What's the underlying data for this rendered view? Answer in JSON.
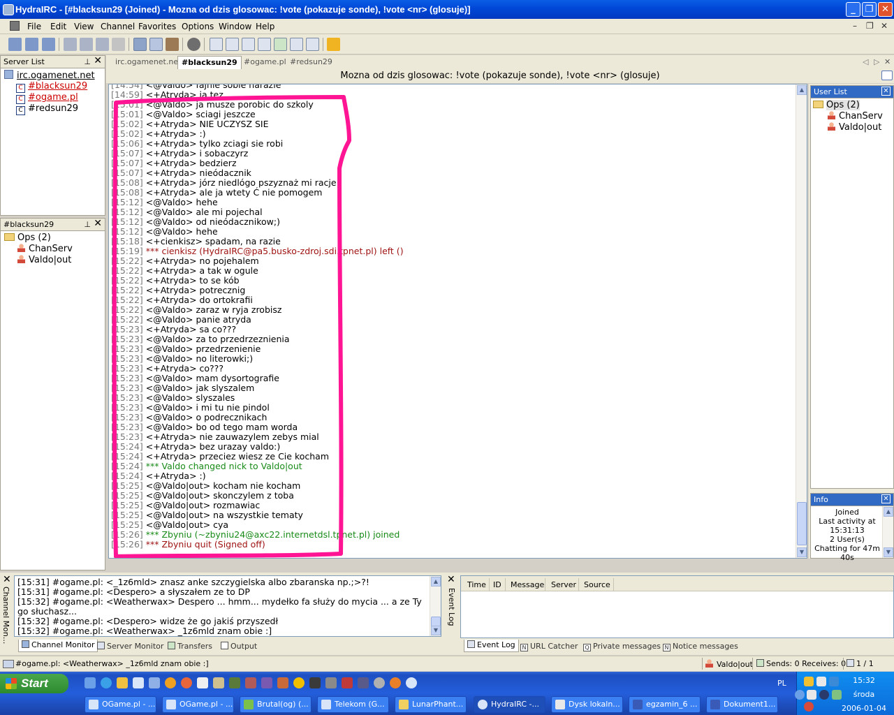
{
  "window": {
    "title": "HydraIRC - [#blacksun29 (Joined) - Mozna od dzis glosowac: !vote (pokazuje sonde), !vote <nr> (glosuje)]",
    "minimize": "_",
    "maximize": "❐",
    "close": "✕"
  },
  "menu": [
    "File",
    "Edit",
    "View",
    "Channel",
    "Favorites",
    "Options",
    "Window",
    "Help"
  ],
  "mdi_controls": {
    "minimize": "–",
    "restore": "❐",
    "close": "✕"
  },
  "server_list": {
    "header": "Server List",
    "server": "irc.ogamenet.net",
    "channels": [
      "#blacksun29",
      "#ogame.pl",
      "#redsun29"
    ]
  },
  "channel_panel": {
    "header": "#blacksun29",
    "ops_label": "Ops (2)",
    "users": [
      "ChanServ",
      "Valdo|out"
    ]
  },
  "tabs": [
    "irc.ogamenet.net",
    "#blacksun29",
    "#ogame.pl",
    "#redsun29"
  ],
  "topic": "Mozna od dzis glosowac: !vote (pokazuje sonde), !vote <nr> (glosuje)",
  "chat": [
    {
      "ts": "[14:54]",
      "text": "<@Valdo> fajnie sobie narazie",
      "style": "normal"
    },
    {
      "ts": "[14:59]",
      "text": "<+Atryda> ja tez",
      "style": "normal"
    },
    {
      "ts": "[15:01]",
      "text": "<@Valdo> ja musze porobic do szkoly",
      "style": "normal"
    },
    {
      "ts": "[15:01]",
      "text": "<@Valdo> sciagi jeszcze",
      "style": "normal"
    },
    {
      "ts": "[15:02]",
      "text": "<+Atryda> NIE UCZYSZ SIE",
      "style": "normal"
    },
    {
      "ts": "[15:02]",
      "text": "<+Atryda> :)",
      "style": "normal"
    },
    {
      "ts": "[15:06]",
      "text": "<+Atryda> tylko zciagi sie robi",
      "style": "normal"
    },
    {
      "ts": "[15:07]",
      "text": "<+Atryda> i sobaczyrz",
      "style": "normal"
    },
    {
      "ts": "[15:07]",
      "text": "<+Atryda> bedzierz",
      "style": "normal"
    },
    {
      "ts": "[15:07]",
      "text": "<+Atryda> nieódacznik",
      "style": "normal"
    },
    {
      "ts": "[15:08]",
      "text": "<+Atryda> jórz niedlógo pszyznaż mi racje",
      "style": "normal"
    },
    {
      "ts": "[15:08]",
      "text": "<+Atryda> ale ja wtety Ć nie pomogem",
      "style": "normal"
    },
    {
      "ts": "[15:12]",
      "text": "<@Valdo> hehe",
      "style": "normal"
    },
    {
      "ts": "[15:12]",
      "text": "<@Valdo> ale mi pojechal",
      "style": "normal"
    },
    {
      "ts": "[15:12]",
      "text": "<@Valdo> od nieódacznikow;)",
      "style": "normal"
    },
    {
      "ts": "[15:12]",
      "text": "<@Valdo> hehe",
      "style": "normal"
    },
    {
      "ts": "[15:18]",
      "text": "<+cienkisz> spadam, na razie",
      "style": "normal"
    },
    {
      "ts": "[15:19]",
      "text": "*** cienkisz (HydraIRC@pa5.busko-zdroj.sdi.tpnet.pl) left ()",
      "style": "red"
    },
    {
      "ts": "[15:22]",
      "text": "<+Atryda> no pojehalem",
      "style": "normal"
    },
    {
      "ts": "[15:22]",
      "text": "<+Atryda> a tak w ogule",
      "style": "normal"
    },
    {
      "ts": "[15:22]",
      "text": "<+Atryda> to se kób",
      "style": "normal"
    },
    {
      "ts": "[15:22]",
      "text": "<+Atryda> potrecznig",
      "style": "normal"
    },
    {
      "ts": "[15:22]",
      "text": "<+Atryda> do ortokrafii",
      "style": "normal"
    },
    {
      "ts": "[15:22]",
      "text": "<@Valdo> zaraz w ryja zrobisz",
      "style": "normal"
    },
    {
      "ts": "[15:22]",
      "text": "<@Valdo> panie atryda",
      "style": "normal"
    },
    {
      "ts": "[15:23]",
      "text": "<+Atryda> sa co???",
      "style": "normal"
    },
    {
      "ts": "[15:23]",
      "text": "<@Valdo> za to przedrzeznienia",
      "style": "normal"
    },
    {
      "ts": "[15:23]",
      "text": "<@Valdo> przedrzenienie",
      "style": "normal"
    },
    {
      "ts": "[15:23]",
      "text": "<@Valdo> no literowki;)",
      "style": "normal"
    },
    {
      "ts": "[15:23]",
      "text": "<+Atryda> co???",
      "style": "normal"
    },
    {
      "ts": "[15:23]",
      "text": "<@Valdo> mam dysortografie",
      "style": "normal"
    },
    {
      "ts": "[15:23]",
      "text": "<@Valdo> jak slyszalem",
      "style": "normal"
    },
    {
      "ts": "[15:23]",
      "text": "<@Valdo> slyszales",
      "style": "normal"
    },
    {
      "ts": "[15:23]",
      "text": "<@Valdo> i mi tu nie pindol",
      "style": "normal"
    },
    {
      "ts": "[15:23]",
      "text": "<@Valdo> o podrecznikach",
      "style": "normal"
    },
    {
      "ts": "[15:23]",
      "text": "<@Valdo> bo od tego mam worda",
      "style": "normal"
    },
    {
      "ts": "[15:23]",
      "text": "<+Atryda> nie zauwazylem zebys mial",
      "style": "normal"
    },
    {
      "ts": "[15:24]",
      "text": "<+Atryda> bez urazay valdo:)",
      "style": "normal"
    },
    {
      "ts": "[15:24]",
      "text": "<+Atryda> przeciez wiesz ze Cie kocham",
      "style": "normal"
    },
    {
      "ts": "[15:24]",
      "text": "*** Valdo changed nick to Valdo|out",
      "style": "green"
    },
    {
      "ts": "[15:24]",
      "text": "<+Atryda> :)",
      "style": "normal"
    },
    {
      "ts": "[15:25]",
      "text": "<@Valdo|out> kocham nie kocham",
      "style": "normal"
    },
    {
      "ts": "[15:25]",
      "text": "<@Valdo|out> skonczylem z toba",
      "style": "normal"
    },
    {
      "ts": "[15:25]",
      "text": "<@Valdo|out> rozmawiac",
      "style": "normal"
    },
    {
      "ts": "[15:25]",
      "text": "<@Valdo|out> na wszystkie tematy",
      "style": "normal"
    },
    {
      "ts": "[15:25]",
      "text": "<@Valdo|out> cya",
      "style": "normal"
    },
    {
      "ts": "[15:26]",
      "text": "*** Zbyniu (~zbyniu24@axc22.internetdsl.tpnet.pl) joined",
      "style": "green"
    },
    {
      "ts": "[15:26]",
      "text": "*** Zbyniu quit (Signed off)",
      "style": "red"
    }
  ],
  "user_list": {
    "header": "User List",
    "ops_label": "Ops (2)",
    "users": [
      "ChanServ",
      "Valdo|out"
    ]
  },
  "info": {
    "header": "Info",
    "lines": [
      "Joined",
      "Last activity at",
      "15:31:13",
      "2 User(s)",
      "Chatting for 47m",
      "40s"
    ]
  },
  "channel_monitor": {
    "side_label": "Channel Mon...",
    "lines": [
      "[15:31] #ogame.pl: <_1z6mld> znasz anke szczygielska albo zbaranska np.;>?!",
      "[15:31] #ogame.pl: <Despero> a słyszałem ze to DP",
      "[15:32] #ogame.pl: <Weatherwax> Despero ... hmm... mydełko fa służy do mycia ... a ze  Ty",
      "   go słuchasz...",
      "[15:32] #ogame.pl: <Despero> widze że go jakiś przyszedł",
      "[15:32] #ogame.pl: <Weatherwax> _1z6mld znam obie :]"
    ],
    "tabs": [
      "Channel Monitor",
      "Server Monitor",
      "Transfers",
      "Output"
    ]
  },
  "event_log": {
    "side_label": "Event Log",
    "columns": [
      "Time",
      "ID",
      "Message",
      "Server",
      "Source"
    ],
    "tabs": [
      "Event Log",
      "URL Catcher",
      "Private messages",
      "Notice messages"
    ]
  },
  "status": {
    "message": "#ogame.pl: <Weatherwax> _1z6mld znam obie :]",
    "nick": "Valdo|out",
    "counts": "Sends: 0 Receives: 0",
    "pages": "1 / 1"
  },
  "taskbar": {
    "start": "Start",
    "tasks": [
      "OGame.pl - ...",
      "OGame.pl - ...",
      "Brutal(og) (...",
      "Telekom (G...",
      "LunarPhant...",
      "HydraIRC -...",
      "Dysk lokaln...",
      "egzamin_6 ...",
      "Dokument1..."
    ],
    "lang": "PL",
    "time": "15:32",
    "day": "środa",
    "date": "2006-01-04"
  },
  "colors": {
    "highlight": "#ff1493",
    "title_blue": "#0a5ee6",
    "join_green": "#178a17",
    "quit_red": "#a01313"
  }
}
